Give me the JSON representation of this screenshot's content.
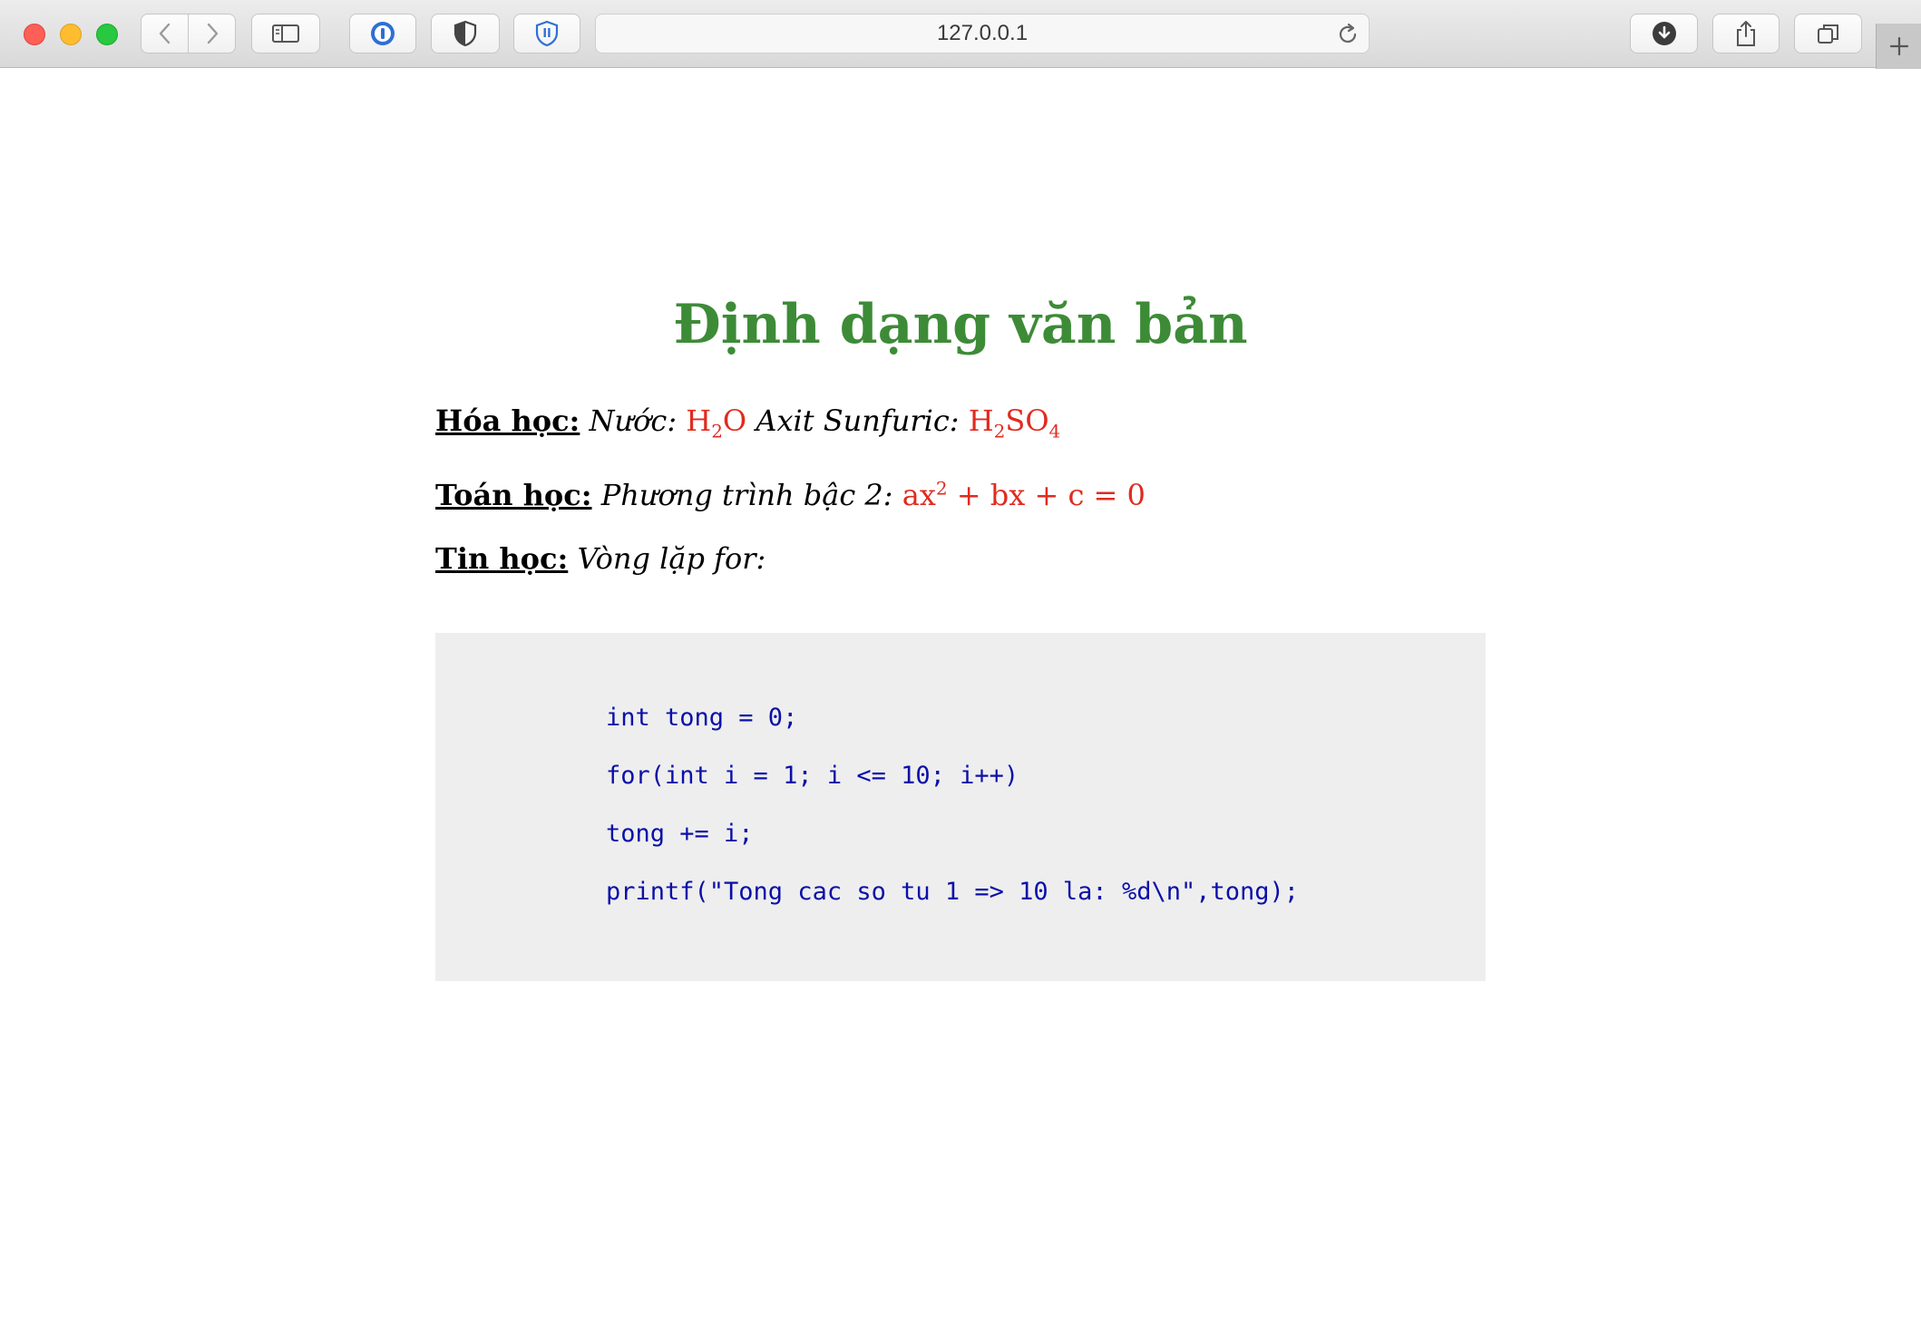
{
  "browser": {
    "url": "127.0.0.1"
  },
  "page": {
    "heading": "Định dạng văn bản",
    "chemistry": {
      "label": "Hóa học:",
      "water_label": "Nước:",
      "water_h": "H",
      "water_sub": "2",
      "water_o": "O",
      "acid_label": "Axit Sunfuric:",
      "acid_h": "H",
      "acid_sub1": "2",
      "acid_so": "SO",
      "acid_sub2": "4"
    },
    "math": {
      "label": "Toán học:",
      "desc": "Phương trình bậc 2:",
      "eq_a": "ax",
      "eq_exp": "2",
      "eq_rest": " + bx + c = 0"
    },
    "informatics": {
      "label": "Tin học:",
      "desc": "Vòng lặp for:"
    },
    "code_lines": [
      "int tong = 0;",
      "for(int i = 1; i <= 10; i++)",
      "tong += i;",
      "printf(\"Tong cac so tu 1 => 10 la: %d\\n\",tong);"
    ]
  },
  "colors": {
    "heading": "#3d8b37",
    "formula": "#e02b1f",
    "code_text": "#0b10a8",
    "code_bg": "#eeeeee"
  }
}
